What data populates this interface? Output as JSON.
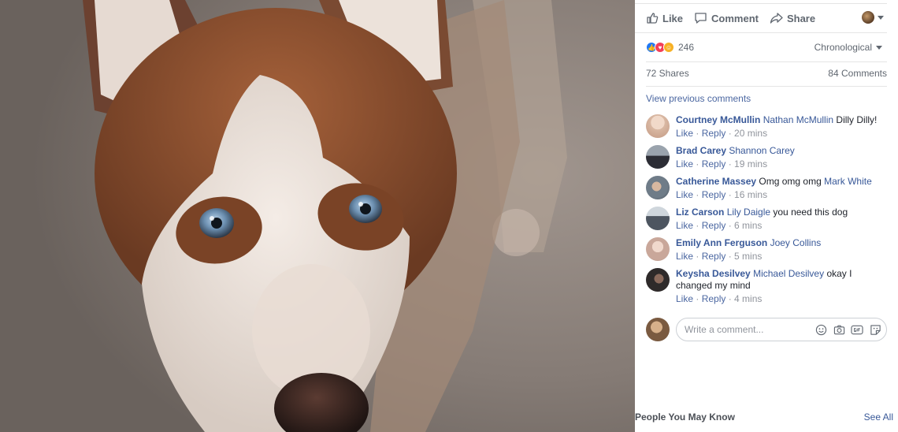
{
  "actions": {
    "like": "Like",
    "comment": "Comment",
    "share": "Share"
  },
  "reactions": {
    "count": "246",
    "sort": "Chronological"
  },
  "stats": {
    "shares": "72 Shares",
    "comments": "84 Comments"
  },
  "view_previous": "View previous comments",
  "comments": [
    {
      "author": "Courtney McMullin",
      "tag": "Nathan McMullin",
      "text": " Dilly Dilly!",
      "time": "20 mins",
      "avatar_color": "#d9b8a3"
    },
    {
      "author": "Brad Carey",
      "tag": "Shannon Carey",
      "text": "",
      "time": "19 mins",
      "avatar_color": "#3a3a44"
    },
    {
      "author": "Catherine Massey",
      "tag": "Mark White",
      "text_before": " Omg omg omg ",
      "time": "16 mins",
      "avatar_color": "#7b8a9a"
    },
    {
      "author": "Liz Carson",
      "tag": "Lily Daigle",
      "text": " you need this dog",
      "time": "6 mins",
      "avatar_color": "#4d5560"
    },
    {
      "author": "Emily Ann Ferguson",
      "tag": "Joey Collins",
      "text": "",
      "time": "5 mins",
      "avatar_color": "#c9a79a"
    },
    {
      "author": "Keysha Desilvey",
      "tag": "Michael Desilvey",
      "text": " okay I changed my mind",
      "time": "4 mins",
      "avatar_color": "#2e2a2a"
    }
  ],
  "meta": {
    "like": "Like",
    "reply": "Reply",
    "sep": " · "
  },
  "composer": {
    "placeholder": "Write a comment..."
  },
  "pymk": {
    "title": "People You May Know",
    "see_all": "See All"
  },
  "colors": {
    "link": "#385898",
    "like_blue": "#2078f4",
    "love_red": "#f33e58",
    "haha_yellow": "#f7b125"
  }
}
